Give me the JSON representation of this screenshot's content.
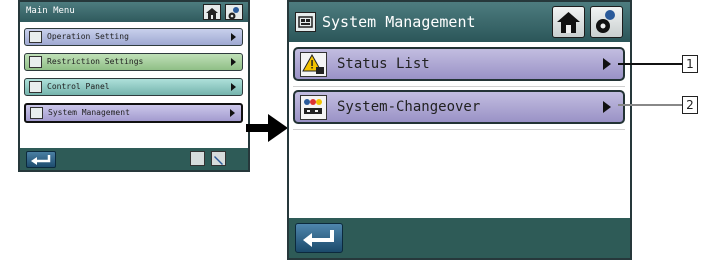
{
  "main_menu": {
    "title": "Main Menu",
    "items": [
      {
        "label": "Operation Setting",
        "bg": "#aeb8dc"
      },
      {
        "label": "Restriction Settings",
        "bg": "#a6cf9f"
      },
      {
        "label": "Control Panel",
        "bg": "#8fc6c1"
      },
      {
        "label": "System Management",
        "bg": "#b4b0d8",
        "selected": true
      }
    ],
    "header_icons": [
      "home-icon",
      "gear-person-icon"
    ],
    "footer_icons": [
      "back-icon",
      "maintenance-icon",
      "wrench-icon"
    ]
  },
  "system_management": {
    "title": "System Management",
    "header_icons": [
      "home-icon",
      "gear-person-icon"
    ],
    "items": [
      {
        "label": "Status List",
        "icon": "warning-icon"
      },
      {
        "label": "System-Changeover",
        "icon": "changeover-icon"
      }
    ],
    "footer_icons": [
      "back-icon"
    ]
  },
  "callouts": [
    "1",
    "2"
  ],
  "colors": {
    "header": "#3b6a6d",
    "footer": "#2e5b57",
    "item_purple": "#aaa3d1"
  }
}
